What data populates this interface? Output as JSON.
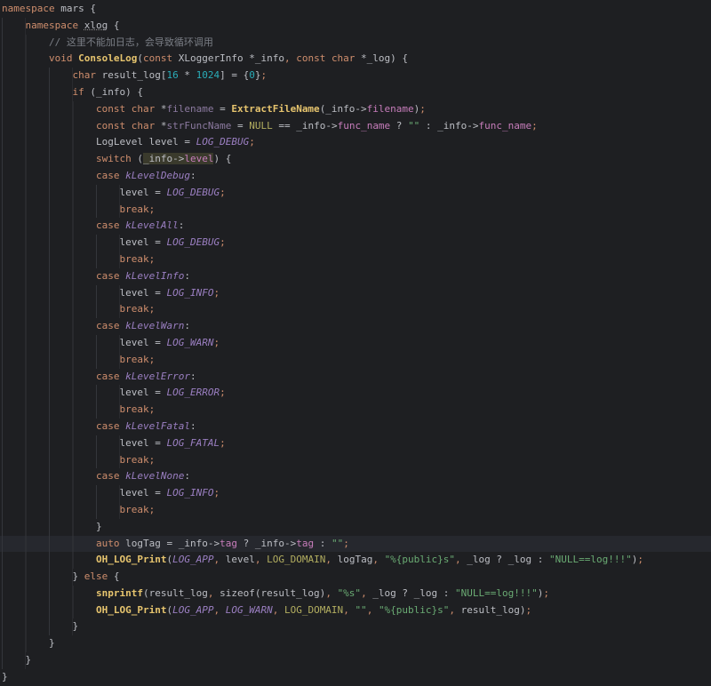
{
  "current_line": 32,
  "lines": [
    {
      "i": 0,
      "t": [
        [
          "k",
          "namespace"
        ],
        [
          "p",
          " mars {"
        ]
      ]
    },
    {
      "i": 1,
      "t": [
        [
          "k",
          "namespace"
        ],
        [
          "p",
          " "
        ],
        [
          "p u",
          "xlog"
        ],
        [
          "p",
          " {"
        ]
      ]
    },
    {
      "i": 2,
      "t": [
        [
          "c",
          "// 这里不能加日志，会导致循环调用"
        ]
      ]
    },
    {
      "i": 2,
      "t": [
        [
          "k",
          "void"
        ],
        [
          "p",
          " "
        ],
        [
          "f",
          "ConsoleLog"
        ],
        [
          "p",
          "("
        ],
        [
          "k",
          "const"
        ],
        [
          "p",
          " XLoggerInfo *_info"
        ],
        [
          "k",
          ","
        ],
        [
          "p",
          " "
        ],
        [
          "k",
          "const char"
        ],
        [
          "p",
          " *_log) {"
        ]
      ]
    },
    {
      "i": 3,
      "t": [
        [
          "k",
          "char"
        ],
        [
          "p",
          " result_log["
        ],
        [
          "n",
          "16"
        ],
        [
          "p",
          " * "
        ],
        [
          "n",
          "1024"
        ],
        [
          "p",
          "] = {"
        ],
        [
          "n",
          "0"
        ],
        [
          "p",
          "}"
        ],
        [
          "k",
          ";"
        ]
      ]
    },
    {
      "i": 3,
      "t": [
        [
          "k",
          "if"
        ],
        [
          "p",
          " (_info) {"
        ]
      ]
    },
    {
      "i": 4,
      "t": [
        [
          "k",
          "const char"
        ],
        [
          "p",
          " *"
        ],
        [
          "dim",
          "filename"
        ],
        [
          "p",
          " = "
        ],
        [
          "f",
          "ExtractFileName"
        ],
        [
          "p",
          "(_info->"
        ],
        [
          "fld",
          "filename"
        ],
        [
          "p",
          ")"
        ],
        [
          "k",
          ";"
        ]
      ]
    },
    {
      "i": 4,
      "t": [
        [
          "k",
          "const char"
        ],
        [
          "p",
          " *"
        ],
        [
          "dim",
          "strFuncName"
        ],
        [
          "p",
          " = "
        ],
        [
          "mc",
          "NULL"
        ],
        [
          "p",
          " == _info->"
        ],
        [
          "fld",
          "func_name"
        ],
        [
          "p",
          " ? "
        ],
        [
          "s",
          "\"\""
        ],
        [
          "p",
          " : _info->"
        ],
        [
          "fld",
          "func_name"
        ],
        [
          "k",
          ";"
        ]
      ]
    },
    {
      "i": 4,
      "t": [
        [
          "p",
          "LogLevel level = "
        ],
        [
          "m",
          "LOG_DEBUG"
        ],
        [
          "k",
          ";"
        ]
      ]
    },
    {
      "i": 4,
      "t": [
        [
          "k",
          "switch"
        ],
        [
          "p",
          " ("
        ],
        [
          "p hl",
          "_info->"
        ],
        [
          "fld hl",
          "level"
        ],
        [
          "p",
          ") {"
        ]
      ]
    },
    {
      "i": 4,
      "t": [
        [
          "k",
          "case"
        ],
        [
          "p",
          " "
        ],
        [
          "e",
          "kLevelDebug"
        ],
        [
          "p",
          ":"
        ]
      ]
    },
    {
      "i": 5,
      "t": [
        [
          "p",
          "level = "
        ],
        [
          "m",
          "LOG_DEBUG"
        ],
        [
          "k",
          ";"
        ]
      ]
    },
    {
      "i": 5,
      "t": [
        [
          "k",
          "break;"
        ]
      ]
    },
    {
      "i": 4,
      "t": [
        [
          "k",
          "case"
        ],
        [
          "p",
          " "
        ],
        [
          "e",
          "kLevelAll"
        ],
        [
          "p",
          ":"
        ]
      ]
    },
    {
      "i": 5,
      "t": [
        [
          "p",
          "level = "
        ],
        [
          "m",
          "LOG_DEBUG"
        ],
        [
          "k",
          ";"
        ]
      ]
    },
    {
      "i": 5,
      "t": [
        [
          "k",
          "break;"
        ]
      ]
    },
    {
      "i": 4,
      "t": [
        [
          "k",
          "case"
        ],
        [
          "p",
          " "
        ],
        [
          "e",
          "kLevelInfo"
        ],
        [
          "p",
          ":"
        ]
      ]
    },
    {
      "i": 5,
      "t": [
        [
          "p",
          "level = "
        ],
        [
          "m",
          "LOG_INFO"
        ],
        [
          "k",
          ";"
        ]
      ]
    },
    {
      "i": 5,
      "t": [
        [
          "k",
          "break;"
        ]
      ]
    },
    {
      "i": 4,
      "t": [
        [
          "k",
          "case"
        ],
        [
          "p",
          " "
        ],
        [
          "e",
          "kLevelWarn"
        ],
        [
          "p",
          ":"
        ]
      ]
    },
    {
      "i": 5,
      "t": [
        [
          "p",
          "level = "
        ],
        [
          "m",
          "LOG_WARN"
        ],
        [
          "k",
          ";"
        ]
      ]
    },
    {
      "i": 5,
      "t": [
        [
          "k",
          "break;"
        ]
      ]
    },
    {
      "i": 4,
      "t": [
        [
          "k",
          "case"
        ],
        [
          "p",
          " "
        ],
        [
          "e",
          "kLevelError"
        ],
        [
          "p",
          ":"
        ]
      ]
    },
    {
      "i": 5,
      "t": [
        [
          "p",
          "level = "
        ],
        [
          "m",
          "LOG_ERROR"
        ],
        [
          "k",
          ";"
        ]
      ]
    },
    {
      "i": 5,
      "t": [
        [
          "k",
          "break;"
        ]
      ]
    },
    {
      "i": 4,
      "t": [
        [
          "k",
          "case"
        ],
        [
          "p",
          " "
        ],
        [
          "e",
          "kLevelFatal"
        ],
        [
          "p",
          ":"
        ]
      ]
    },
    {
      "i": 5,
      "t": [
        [
          "p",
          "level = "
        ],
        [
          "m",
          "LOG_FATAL"
        ],
        [
          "k",
          ";"
        ]
      ]
    },
    {
      "i": 5,
      "t": [
        [
          "k",
          "break;"
        ]
      ]
    },
    {
      "i": 4,
      "t": [
        [
          "k",
          "case"
        ],
        [
          "p",
          " "
        ],
        [
          "e",
          "kLevelNone"
        ],
        [
          "p",
          ":"
        ]
      ]
    },
    {
      "i": 5,
      "t": [
        [
          "p",
          "level = "
        ],
        [
          "m",
          "LOG_INFO"
        ],
        [
          "k",
          ";"
        ]
      ]
    },
    {
      "i": 5,
      "t": [
        [
          "k",
          "break;"
        ]
      ]
    },
    {
      "i": 4,
      "t": [
        [
          "p",
          "}"
        ]
      ]
    },
    {
      "i": 4,
      "t": [
        [
          "k",
          "auto"
        ],
        [
          "p",
          " logTag = _info->"
        ],
        [
          "fld",
          "tag"
        ],
        [
          "p",
          " ? _info->"
        ],
        [
          "fld",
          "tag"
        ],
        [
          "p",
          " : "
        ],
        [
          "s",
          "\"\""
        ],
        [
          "k",
          ";"
        ]
      ]
    },
    {
      "i": 4,
      "t": [
        [
          "f",
          "OH_LOG_Print"
        ],
        [
          "p",
          "("
        ],
        [
          "m",
          "LOG_APP"
        ],
        [
          "k",
          ","
        ],
        [
          "p",
          " level"
        ],
        [
          "k",
          ","
        ],
        [
          "p",
          " "
        ],
        [
          "mc",
          "LOG_DOMAIN"
        ],
        [
          "k",
          ","
        ],
        [
          "p",
          " logTag"
        ],
        [
          "k",
          ","
        ],
        [
          "p",
          " "
        ],
        [
          "s",
          "\"%{public}s\""
        ],
        [
          "k",
          ","
        ],
        [
          "p",
          " _log ? _log : "
        ],
        [
          "s",
          "\"NULL==log!!!\""
        ],
        [
          "p",
          ")"
        ],
        [
          "k",
          ";"
        ]
      ]
    },
    {
      "i": 3,
      "t": [
        [
          "p",
          "} "
        ],
        [
          "k",
          "else"
        ],
        [
          "p",
          " {"
        ]
      ]
    },
    {
      "i": 4,
      "t": [
        [
          "f",
          "snprintf"
        ],
        [
          "p",
          "(result_log"
        ],
        [
          "k",
          ","
        ],
        [
          "p",
          " sizeof(result_log)"
        ],
        [
          "k",
          ","
        ],
        [
          "p",
          " "
        ],
        [
          "s",
          "\"%s\""
        ],
        [
          "k",
          ","
        ],
        [
          "p",
          " _log ? _log : "
        ],
        [
          "s",
          "\"NULL==log!!!\""
        ],
        [
          "p",
          ")"
        ],
        [
          "k",
          ";"
        ]
      ]
    },
    {
      "i": 4,
      "t": [
        [
          "f",
          "OH_LOG_Print"
        ],
        [
          "p",
          "("
        ],
        [
          "m",
          "LOG_APP"
        ],
        [
          "k",
          ","
        ],
        [
          "p",
          " "
        ],
        [
          "m",
          "LOG_WARN"
        ],
        [
          "k",
          ","
        ],
        [
          "p",
          " "
        ],
        [
          "mc",
          "LOG_DOMAIN"
        ],
        [
          "k",
          ","
        ],
        [
          "p",
          " "
        ],
        [
          "s",
          "\"\""
        ],
        [
          "k",
          ","
        ],
        [
          "p",
          " "
        ],
        [
          "s",
          "\"%{public}s\""
        ],
        [
          "k",
          ","
        ],
        [
          "p",
          " result_log)"
        ],
        [
          "k",
          ";"
        ]
      ]
    },
    {
      "i": 3,
      "t": [
        [
          "p",
          "}"
        ]
      ]
    },
    {
      "i": 2,
      "t": [
        [
          "p",
          "}"
        ]
      ]
    },
    {
      "i": 1,
      "t": [
        [
          "p",
          "}"
        ]
      ]
    },
    {
      "i": 0,
      "t": [
        [
          "p",
          "}"
        ]
      ]
    }
  ]
}
